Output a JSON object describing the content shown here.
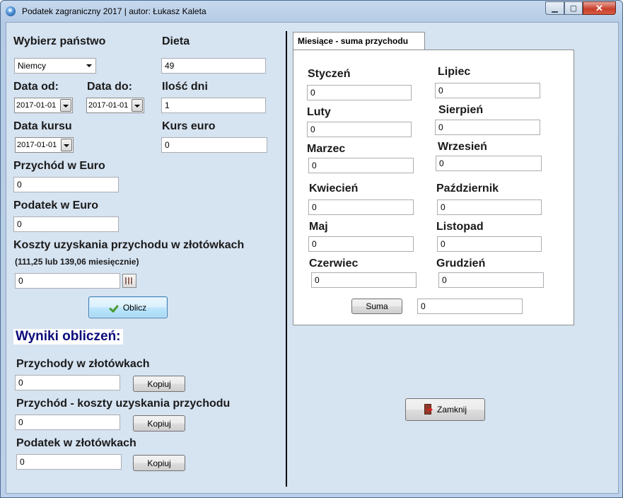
{
  "window": {
    "title": "Podatek zagraniczny 2017 | autor: Łukasz Kaleta"
  },
  "left": {
    "country_label": "Wybierz państwo",
    "country_value": "Niemcy",
    "dieta_label": "Dieta",
    "dieta_value": "49",
    "date_from_label": "Data od:",
    "date_from_value": "2017-01-01",
    "date_to_label": "Data do:",
    "date_to_value": "2017-01-01",
    "days_label": "Ilość dni",
    "days_value": "1",
    "rate_date_label": "Data kursu",
    "rate_date_value": "2017-01-01",
    "euro_rate_label": "Kurs euro",
    "euro_rate_value": "0",
    "income_eur_label": "Przychód w Euro",
    "income_eur_value": "0",
    "tax_eur_label": "Podatek w Euro",
    "tax_eur_value": "0",
    "costs_label": "Koszty uzyskania przychodu w złotówkach",
    "costs_hint": "(111,25 lub 139,06 miesięcznie)",
    "costs_value": "0",
    "calculate_button": "Oblicz"
  },
  "results": {
    "heading": "Wyniki obliczeń:",
    "income_pln_label": "Przychody w złotówkach",
    "income_pln_value": "0",
    "income_minus_costs_label": "Przychód - koszty uzyskania przychodu",
    "income_minus_costs_value": "0",
    "tax_pln_label": "Podatek w złotówkach",
    "tax_pln_value": "0",
    "copy_button": "Kopiuj"
  },
  "months_tab": {
    "tab_label": "Miesiące - suma przychodu",
    "months": [
      {
        "name": "Styczeń",
        "value": "0"
      },
      {
        "name": "Luty",
        "value": "0"
      },
      {
        "name": "Marzec",
        "value": "0"
      },
      {
        "name": "Kwiecień",
        "value": "0"
      },
      {
        "name": "Maj",
        "value": "0"
      },
      {
        "name": "Czerwiec",
        "value": "0"
      },
      {
        "name": "Lipiec",
        "value": "0"
      },
      {
        "name": "Sierpień",
        "value": "0"
      },
      {
        "name": "Wrzesień",
        "value": "0"
      },
      {
        "name": "Październik",
        "value": "0"
      },
      {
        "name": "Listopad",
        "value": "0"
      },
      {
        "name": "Grudzień",
        "value": "0"
      }
    ],
    "sum_button": "Suma",
    "sum_value": "0"
  },
  "close_button": "Zamknij"
}
